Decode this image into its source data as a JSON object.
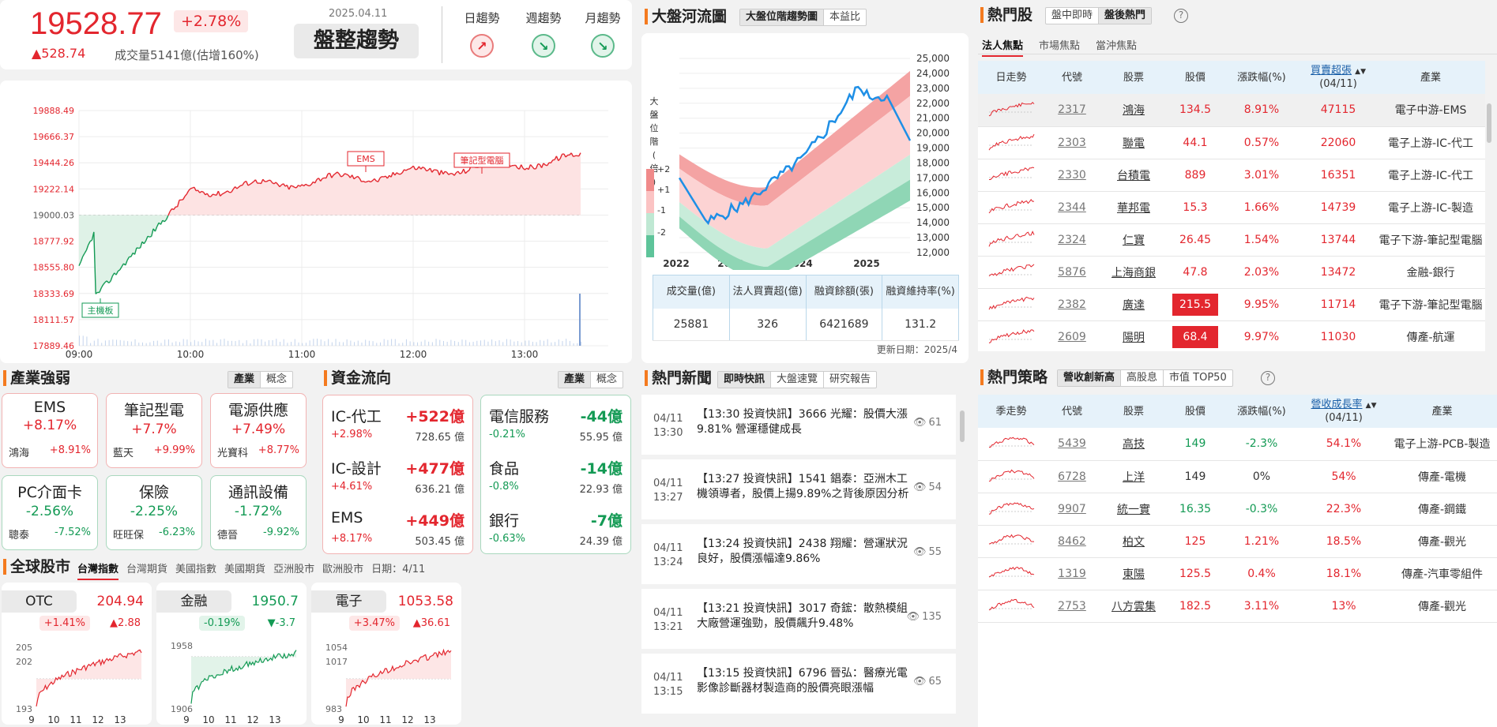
{
  "summary": {
    "index": "19528.77",
    "pct": "+2.78%",
    "change": "▲528.74",
    "volume": "成交量5141億(估增160%)",
    "date": "2025.04.11",
    "trend": "盤整趨勢",
    "trends": [
      {
        "label": "日趨勢",
        "dir": "up"
      },
      {
        "label": "週趨勢",
        "dir": "down"
      },
      {
        "label": "月趨勢",
        "dir": "down"
      }
    ]
  },
  "intraday": {
    "y_ticks": [
      "19888.49",
      "19666.37",
      "19444.26",
      "19222.14",
      "19000.03",
      "18777.92",
      "18555.80",
      "18333.69",
      "18111.57",
      "17889.46"
    ],
    "x_ticks": [
      "09:00",
      "10:00",
      "11:00",
      "12:00",
      "13:00"
    ],
    "annotations": [
      "EMS",
      "筆記型電腦",
      "主機板"
    ],
    "open": 19000.03,
    "close": 19528.77,
    "ylim": [
      17889.46,
      19888.49
    ]
  },
  "river": {
    "title": "大盤河流圖",
    "tabs": [
      "大盤位階趨勢圖",
      "本益比"
    ],
    "y_ticks": [
      "25,000",
      "24,000",
      "23,000",
      "22,000",
      "21,000",
      "20,000",
      "19,000",
      "18,000",
      "17,000",
      "16,000",
      "15,000",
      "14,000",
      "13,000",
      "12,000"
    ],
    "x_ticks": [
      "2022",
      "2023",
      "2024",
      "2025"
    ],
    "band_label": "大盤位階(倍)",
    "band_values": [
      "+2",
      "+1",
      "-1",
      "-2"
    ],
    "stats_headers": [
      "成交量(億)",
      "法人買賣超(億)",
      "融資餘額(張)",
      "融資維持率(%)"
    ],
    "stats_values": [
      "25881",
      "326",
      "6421689",
      "131.2"
    ],
    "updated": "更新日期：2025/4"
  },
  "hot": {
    "title": "熱門股",
    "tabs": [
      "盤中即時",
      "盤後熱門"
    ],
    "subtabs": [
      "法人焦點",
      "市場焦點",
      "當沖焦點"
    ],
    "headers": [
      "日走勢",
      "代號",
      "股票",
      "股價",
      "漲跌幅(%)",
      "買賣超張",
      "(04/11)",
      "產業"
    ],
    "rows": [
      [
        "2317",
        "鴻海",
        "134.5",
        "8.91%",
        "47115",
        "電子中游-EMS"
      ],
      [
        "2303",
        "聯電",
        "44.1",
        "0.57%",
        "22060",
        "電子上游-IC-代工"
      ],
      [
        "2330",
        "台積電",
        "889",
        "3.01%",
        "16351",
        "電子上游-IC-代工"
      ],
      [
        "2344",
        "華邦電",
        "15.3",
        "1.66%",
        "14739",
        "電子上游-IC-製造"
      ],
      [
        "2324",
        "仁寶",
        "26.45",
        "1.54%",
        "13744",
        "電子下游-筆記型電腦"
      ],
      [
        "5876",
        "上海商銀",
        "47.8",
        "2.03%",
        "13472",
        "金融-銀行"
      ],
      [
        "2382",
        "廣達",
        "215.5",
        "9.95%",
        "11714",
        "電子下游-筆記型電腦"
      ],
      [
        "2609",
        "陽明",
        "68.4",
        "9.97%",
        "11030",
        "傳產-航運"
      ]
    ]
  },
  "industry": {
    "title": "產業強弱",
    "tabs": [
      "產業",
      "概念"
    ],
    "cards": [
      {
        "name": "EMS",
        "pct": "+8.17%",
        "stock": "鴻海",
        "spct": "+8.91%"
      },
      {
        "name": "筆記型電",
        "pct": "+7.7%",
        "stock": "藍天",
        "spct": "+9.99%"
      },
      {
        "name": "電源供應",
        "pct": "+7.49%",
        "stock": "光寶科",
        "spct": "+8.77%"
      },
      {
        "name": "PC介面卡",
        "pct": "-2.56%",
        "stock": "聰泰",
        "spct": "-7.52%"
      },
      {
        "name": "保險",
        "pct": "-2.25%",
        "stock": "旺旺保",
        "spct": "-6.23%"
      },
      {
        "name": "通訊設備",
        "pct": "-1.72%",
        "stock": "德晉",
        "spct": "-9.92%"
      }
    ]
  },
  "flow": {
    "title": "資金流向",
    "tabs": [
      "產業",
      "概念"
    ],
    "up": [
      {
        "name": "IC-代工",
        "value": "+522億",
        "pct": "+2.98%",
        "amt": "728.65 億"
      },
      {
        "name": "IC-設計",
        "value": "+477億",
        "pct": "+4.61%",
        "amt": "636.21 億"
      },
      {
        "name": "EMS",
        "value": "+449億",
        "pct": "+8.17%",
        "amt": "503.45 億"
      }
    ],
    "down": [
      {
        "name": "電信服務",
        "value": "-44億",
        "pct": "-0.21%",
        "amt": "55.95 億"
      },
      {
        "name": "食品",
        "value": "-14億",
        "pct": "-0.8%",
        "amt": "22.93 億"
      },
      {
        "name": "銀行",
        "value": "-7億",
        "pct": "-0.63%",
        "amt": "24.39 億"
      }
    ]
  },
  "global": {
    "title": "全球股市",
    "tabs": [
      "台灣指數",
      "台灣期貨",
      "美國指數",
      "美國期貨",
      "亞洲股市",
      "歐洲股市"
    ],
    "date": "日期：4/11",
    "cards": [
      {
        "name": "OTC",
        "value": "204.94",
        "pct": "+1.41%",
        "chg": "▲2.88",
        "up": true,
        "y": [
          "205",
          "202",
          "193"
        ],
        "x": [
          "9",
          "10",
          "11",
          "12",
          "13"
        ]
      },
      {
        "name": "金融",
        "value": "1950.7",
        "pct": "-0.19%",
        "chg": "▼-3.7",
        "up": false,
        "y": [
          "1958",
          "1906"
        ],
        "x": [
          "9",
          "10",
          "11",
          "12",
          "13"
        ]
      },
      {
        "name": "電子",
        "value": "1053.58",
        "pct": "+3.47%",
        "chg": "▲36.61",
        "up": true,
        "y": [
          "1054",
          "1017",
          "983"
        ],
        "x": [
          "9",
          "10",
          "11",
          "12",
          "13"
        ]
      }
    ]
  },
  "news": {
    "title": "熱門新聞",
    "tabs": [
      "即時快訊",
      "大盤速覽",
      "研究報告"
    ],
    "items": [
      {
        "date": "04/11",
        "time": "13:30",
        "text": "【13:30 投資快訊】3666 光耀：股價大漲9.81% 營運穩健成長",
        "views": "61"
      },
      {
        "date": "04/11",
        "time": "13:27",
        "text": "【13:27 投資快訊】1541 錩泰：亞洲木工機領導者，股價上揚9.89%之背後原因分析",
        "views": "54"
      },
      {
        "date": "04/11",
        "time": "13:24",
        "text": "【13:24 投資快訊】2438 翔耀：營運狀況良好，股價漲幅達9.86%",
        "views": "55"
      },
      {
        "date": "04/11",
        "time": "13:21",
        "text": "【13:21 投資快訊】3017 奇鋐：散熱模組大廠營運強勁，股價飆升9.48%",
        "views": "135"
      },
      {
        "date": "04/11",
        "time": "13:15",
        "text": "【13:15 投資快訊】6796 晉弘：醫療光電影像診斷器材製造商的股價亮眼漲幅",
        "views": "65"
      }
    ]
  },
  "strategy": {
    "title": "熱門策略",
    "tabs": [
      "營收創新高",
      "高股息",
      "市值 TOP50"
    ],
    "headers": [
      "季走勢",
      "代號",
      "股票",
      "股價",
      "漲跌幅(%)",
      "營收成長率",
      "(04/11)",
      "產業"
    ],
    "rows": [
      [
        "5439",
        "高技",
        "149",
        "-2.3%",
        "54.1%",
        "電子上游-PCB-製造"
      ],
      [
        "6728",
        "上洋",
        "149",
        "0%",
        "54%",
        "傳產-電機"
      ],
      [
        "9907",
        "統一實",
        "16.35",
        "-0.3%",
        "22.3%",
        "傳產-鋼鐵"
      ],
      [
        "8462",
        "柏文",
        "125",
        "1.21%",
        "18.5%",
        "傳產-觀光"
      ],
      [
        "1319",
        "東陽",
        "125.5",
        "0.4%",
        "18.1%",
        "傳產-汽車零組件"
      ],
      [
        "2753",
        "八方雲集",
        "182.5",
        "3.11%",
        "13%",
        "傳產-觀光"
      ]
    ]
  }
}
